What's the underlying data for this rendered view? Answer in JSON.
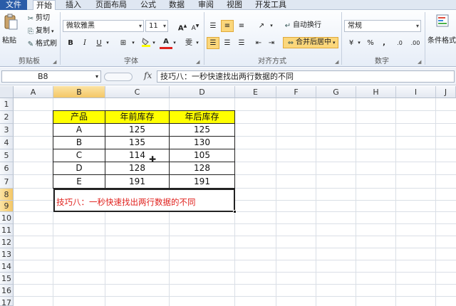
{
  "tabs": [
    "文件",
    "开始",
    "插入",
    "页面布局",
    "公式",
    "数据",
    "审阅",
    "视图",
    "开发工具"
  ],
  "ribbon": {
    "clipboard": {
      "paste": "粘贴",
      "cut": "剪切",
      "copy": "复制",
      "format_painter": "格式刷",
      "group": "剪贴板"
    },
    "font": {
      "name": "微软雅黑",
      "size": "11",
      "bold": "B",
      "italic": "I",
      "underline": "U",
      "grow": "A",
      "shrink": "A",
      "font_color": "A",
      "wen": "雯",
      "group": "字体"
    },
    "alignment": {
      "wrap_text": "自动换行",
      "merge_center": "合并后居中",
      "group": "对齐方式"
    },
    "number": {
      "format": "常规",
      "percent": "%",
      "comma": ",",
      "inc_decimal": ".0",
      "dec_decimal": ".00",
      "group": "数字"
    },
    "styles": {
      "conditional": "条件格式"
    }
  },
  "formula_bar": {
    "name_box": "B8",
    "fx": "fx",
    "content": "技巧八：一秒快速找出两行数据的不同"
  },
  "columns": [
    "A",
    "B",
    "C",
    "D",
    "E",
    "F",
    "G",
    "H",
    "I",
    "J"
  ],
  "rows": [
    "1",
    "2",
    "3",
    "4",
    "5",
    "6",
    "7",
    "8",
    "9",
    "10",
    "11",
    "12",
    "13",
    "14",
    "15",
    "16",
    "17"
  ],
  "table": {
    "headers": [
      "产品",
      "年前库存",
      "年后库存"
    ],
    "rows": [
      [
        "A",
        "125",
        "125"
      ],
      [
        "B",
        "135",
        "130"
      ],
      [
        "C",
        "114",
        "105"
      ],
      [
        "D",
        "128",
        "128"
      ],
      [
        "E",
        "191",
        "191"
      ]
    ]
  },
  "merged_cell_text": "技巧八：一秒快速找出两行数据的不同",
  "colors": {
    "header_fill": "#ffff00",
    "tip_text": "#e0211d",
    "file_tab": "#2a5ca8",
    "selection": "#f4c766"
  }
}
